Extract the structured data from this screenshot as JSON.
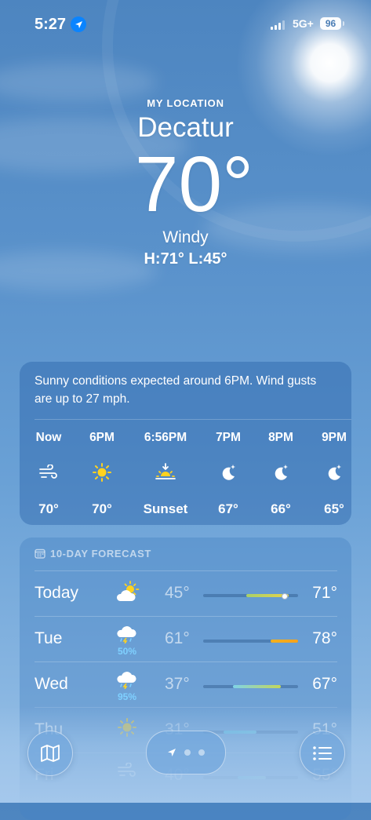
{
  "status_bar": {
    "time": "5:27",
    "network": "5G+",
    "battery": "96"
  },
  "location": {
    "caption": "MY LOCATION",
    "city": "Decatur",
    "temperature": "70°",
    "condition": "Windy",
    "high_low": "H:71°  L:45°"
  },
  "hourly": {
    "summary": "Sunny conditions expected around 6PM. Wind gusts are up to 27 mph.",
    "items": [
      {
        "label": "Now",
        "icon": "wind-icon",
        "value": "70°"
      },
      {
        "label": "6PM",
        "icon": "sun-icon",
        "value": "70°"
      },
      {
        "label": "6:56PM",
        "icon": "sunset-icon",
        "value": "Sunset"
      },
      {
        "label": "7PM",
        "icon": "moon-stars-icon",
        "value": "67°"
      },
      {
        "label": "8PM",
        "icon": "moon-stars-icon",
        "value": "66°"
      },
      {
        "label": "9PM",
        "icon": "moon-stars-icon",
        "value": "65°"
      }
    ]
  },
  "forecast": {
    "title": "10-DAY FORECAST",
    "days": [
      {
        "day": "Today",
        "icon": "partly-sunny-icon",
        "precip": "",
        "low": "45°",
        "high": "71°",
        "range_colors": [
          "#a8d16b",
          "#e6d24a"
        ]
      },
      {
        "day": "Tue",
        "icon": "thunderstorm-rain-icon",
        "precip": "50%",
        "low": "61°",
        "high": "78°",
        "range_colors": [
          "#f2b01e",
          "#f7a21b"
        ]
      },
      {
        "day": "Wed",
        "icon": "thunderstorm-rain-icon",
        "precip": "95%",
        "low": "37°",
        "high": "67°",
        "range_colors": [
          "#7fd3e8",
          "#c3d65a"
        ]
      },
      {
        "day": "Thu",
        "icon": "sun-icon",
        "precip": "",
        "low": "31°",
        "high": "51°",
        "range_colors": [
          "#5cc8e6",
          "#6fd0e8"
        ]
      },
      {
        "day": "Fri",
        "icon": "wind-icon",
        "precip": "",
        "low": "40°",
        "high": "55°",
        "range_colors": [
          "#5cc8e6",
          "#8ed6e0"
        ]
      }
    ]
  },
  "bottom_bar": {
    "map_icon": "map-icon",
    "location_icon": "location-arrow-icon",
    "list_icon": "list-icon"
  },
  "colors": {
    "sky": "#5b93cc",
    "card": "#3a73b4",
    "precip": "#7fd0ff",
    "sun": "#ffd21f"
  }
}
